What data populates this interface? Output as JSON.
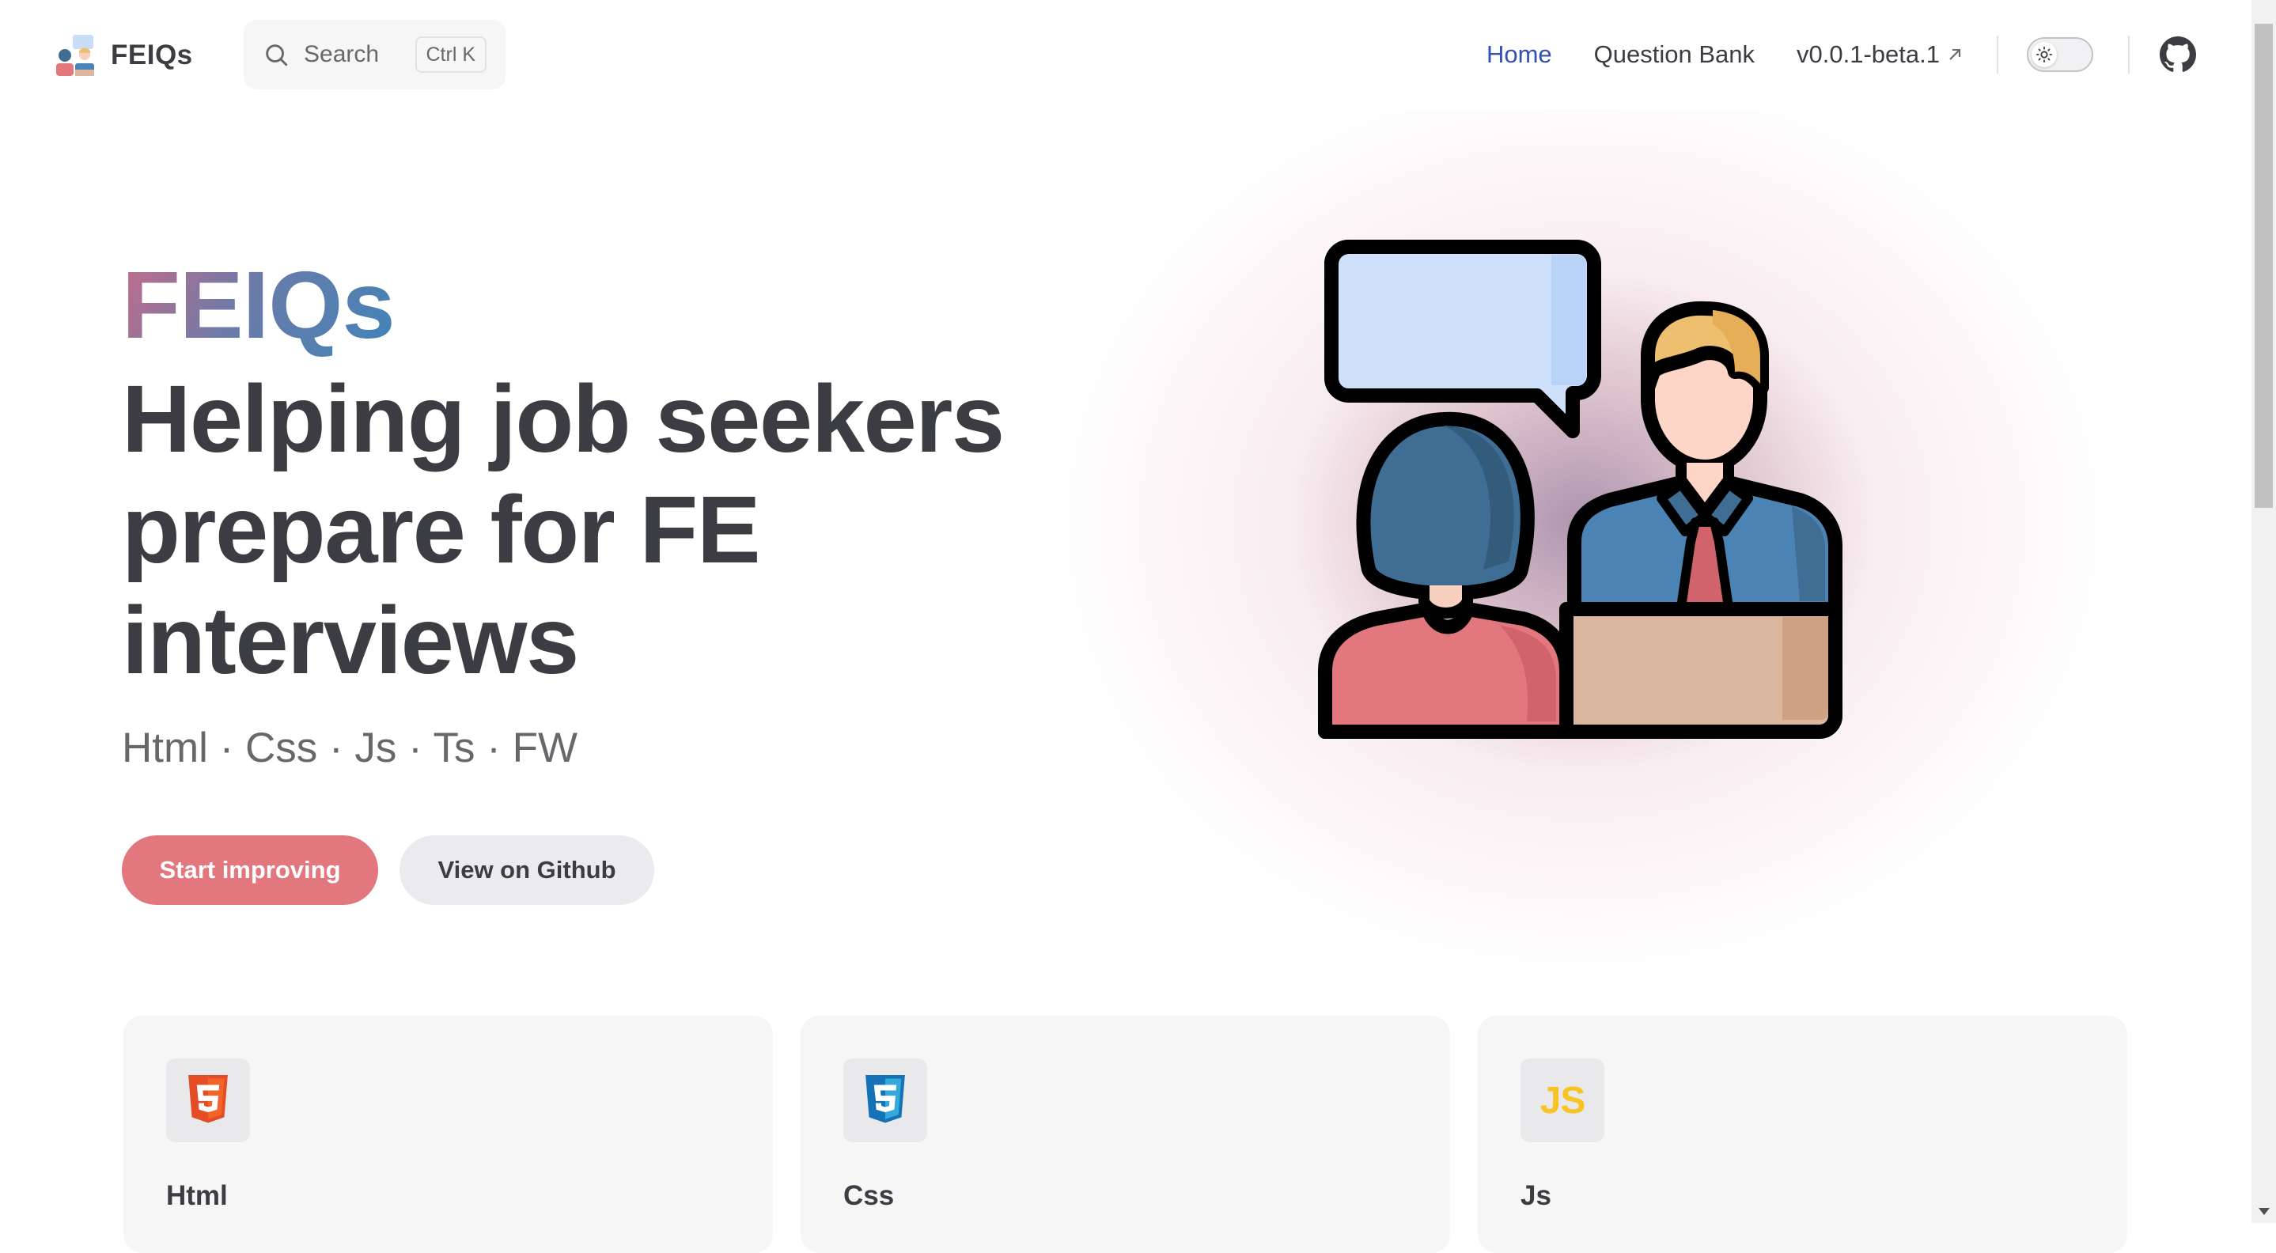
{
  "navbar": {
    "brand_title": "FEIQs",
    "search": {
      "label": "Search",
      "shortcut": "Ctrl K"
    },
    "links": [
      {
        "label": "Home",
        "active": true
      },
      {
        "label": "Question Bank",
        "active": false
      },
      {
        "label": "v0.0.1-beta.1",
        "active": false,
        "external": true
      }
    ],
    "theme_toggle_icon": "sun-icon",
    "social_icon": "github-icon"
  },
  "hero": {
    "name": "FEIQs",
    "text": "Helping job seekers prepare for FE interviews",
    "tagline": "Html · Css · Js · Ts · FW",
    "actions": [
      {
        "label": "Start improving",
        "theme": "brand"
      },
      {
        "label": "View on Github",
        "theme": "alt"
      }
    ],
    "image": "interview-illustration"
  },
  "features": [
    {
      "title": "Html",
      "icon": "html5-icon"
    },
    {
      "title": "Css",
      "icon": "css3-icon"
    },
    {
      "title": "Js",
      "icon": "js-icon",
      "badge": "JS"
    }
  ],
  "colors": {
    "brand": "#e2787e",
    "nav_active": "#3451b2",
    "text": "#3c3c43",
    "text_muted": "#67676c",
    "card_bg": "#f6f6f7"
  }
}
